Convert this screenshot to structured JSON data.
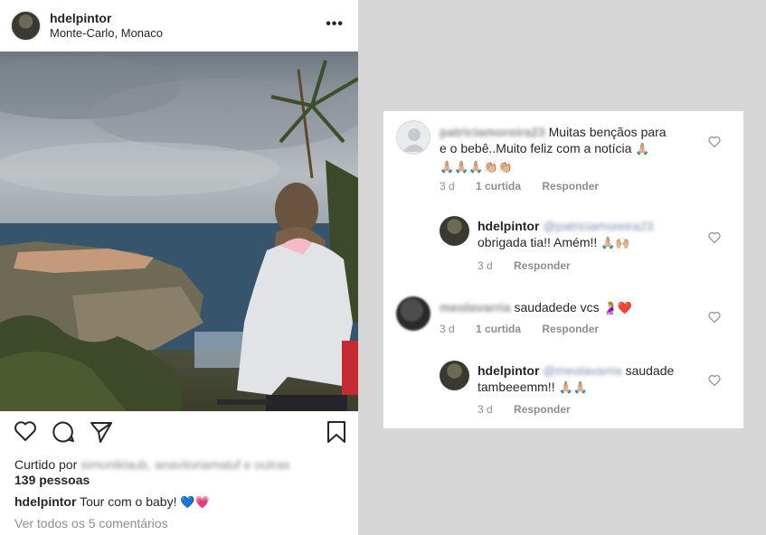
{
  "post": {
    "username": "hdelpintor",
    "location": "Monte-Carlo, Monaco",
    "more_icon": "more-horizontal-icon",
    "liked_prefix": "Curtido por",
    "liked_by": "simoniklaub, anavitoriamaluf e outras",
    "likes_count": "139 pessoas",
    "caption_user": "hdelpintor",
    "caption_text": "Tour com o baby!",
    "caption_emoji": "💙💗",
    "view_comments": "Ver todos os 5 comentários"
  },
  "comments": [
    {
      "username": "patriciamoreira23",
      "text_line1": "Muitas bençãos para",
      "text_line2": "e o bebê..Muito feliz com a notícia",
      "emoji_line1": "🙏🏼",
      "emoji_line2": "🙏🏼🙏🏼🙏🏼👏🏼👏🏼",
      "time": "3 d",
      "likes": "1 curtida",
      "reply": "Responder"
    },
    {
      "username": "hdelpintor",
      "mention": "@patriciamoreira23",
      "text": "obrigada tia!! Amém!!",
      "emoji": "🙏🏼🙌🏼",
      "time": "3 d",
      "reply": "Responder"
    },
    {
      "username": "meolavarria",
      "text": "saudadede vcs",
      "emoji": "🤰🏼❤️",
      "time": "3 d",
      "likes": "1 curtida",
      "reply": "Responder"
    },
    {
      "username": "hdelpintor",
      "mention": "@meolavarria",
      "text_line1": "saudade",
      "text_line2": "tambeeemm!!",
      "emoji": "🙏🏼🙏🏼",
      "time": "3 d",
      "reply": "Responder"
    }
  ],
  "colors": {
    "text": "#262626",
    "muted": "#8e8e8e",
    "mention": "#00376b",
    "background": "#d6d6d6"
  }
}
